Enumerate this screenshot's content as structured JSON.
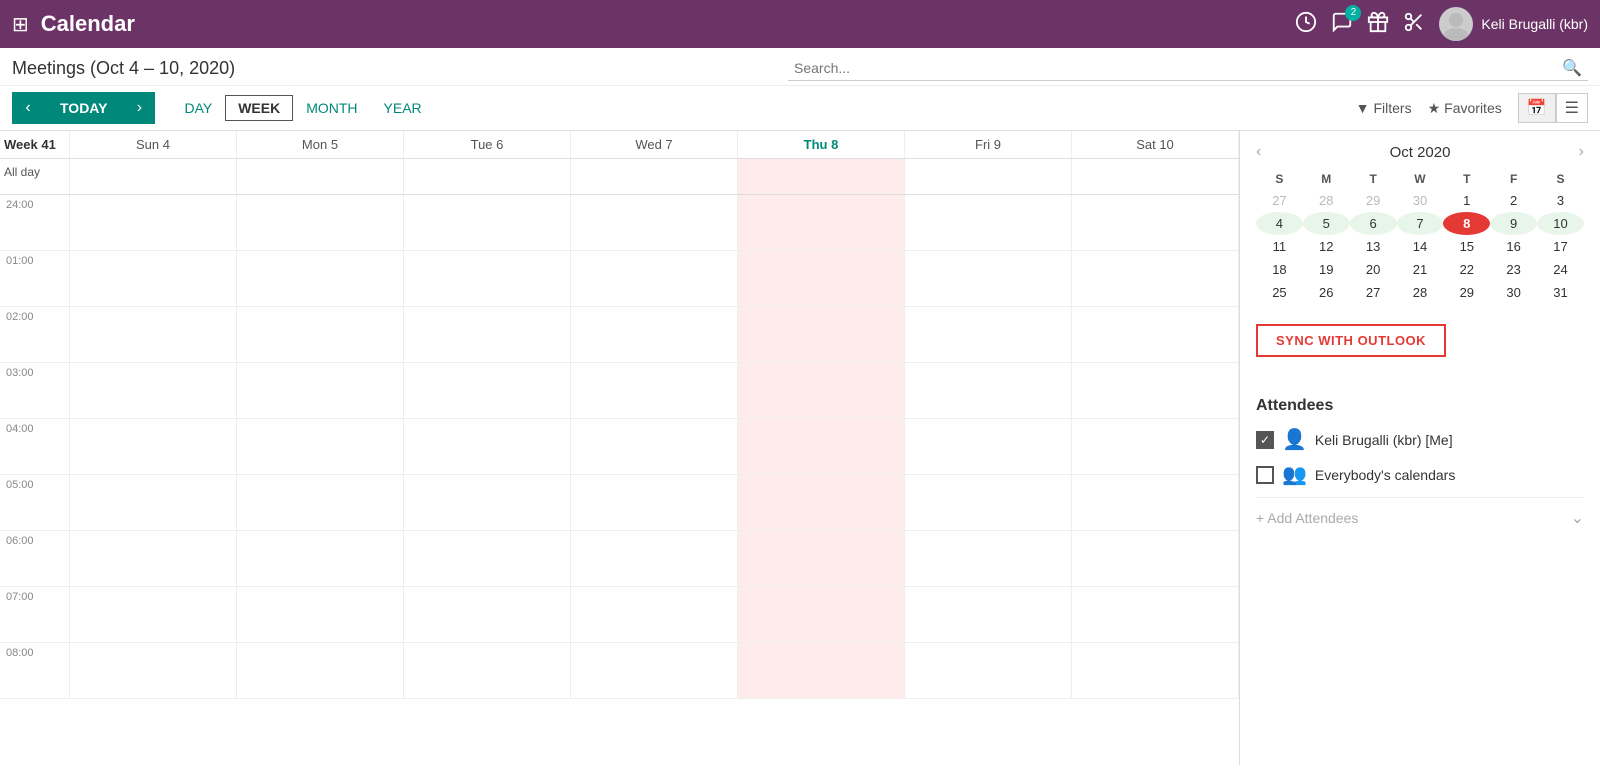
{
  "topnav": {
    "title": "Calendar",
    "chat_badge": "2",
    "user_name": "Keli Brugalli (kbr)"
  },
  "toolbar": {
    "title": "Meetings (Oct 4 – 10, 2020)",
    "search_placeholder": "Search..."
  },
  "nav": {
    "today_label": "TODAY",
    "prev_label": "‹",
    "next_label": "›",
    "views": [
      "DAY",
      "WEEK",
      "MONTH",
      "YEAR"
    ],
    "active_view": "WEEK",
    "filter_label": "Filters",
    "favorites_label": "Favorites"
  },
  "week_header": {
    "week_label": "Week 41",
    "days": [
      "Sun 4",
      "Mon 5",
      "Tue 6",
      "Wed 7",
      "Thu 8",
      "Fri 9",
      "Sat 10"
    ]
  },
  "time_labels": [
    "24:00",
    "01:00",
    "02:00",
    "03:00",
    "04:00",
    "05:00",
    "06:00",
    "07:00"
  ],
  "mini_cal": {
    "title": "Oct 2020",
    "day_headers": [
      "S",
      "M",
      "T",
      "W",
      "T",
      "F",
      "S"
    ],
    "weeks": [
      [
        {
          "n": "27",
          "other": true
        },
        {
          "n": "28",
          "other": true
        },
        {
          "n": "29",
          "other": true
        },
        {
          "n": "30",
          "other": true
        },
        {
          "n": "1"
        },
        {
          "n": "2"
        },
        {
          "n": "3"
        }
      ],
      [
        {
          "n": "4"
        },
        {
          "n": "5"
        },
        {
          "n": "6"
        },
        {
          "n": "7"
        },
        {
          "n": "8",
          "today": true
        },
        {
          "n": "9"
        },
        {
          "n": "10"
        }
      ],
      [
        {
          "n": "11"
        },
        {
          "n": "12"
        },
        {
          "n": "13"
        },
        {
          "n": "14"
        },
        {
          "n": "15"
        },
        {
          "n": "16"
        },
        {
          "n": "17"
        }
      ],
      [
        {
          "n": "18"
        },
        {
          "n": "19"
        },
        {
          "n": "20"
        },
        {
          "n": "21"
        },
        {
          "n": "22"
        },
        {
          "n": "23"
        },
        {
          "n": "24"
        }
      ],
      [
        {
          "n": "25"
        },
        {
          "n": "26"
        },
        {
          "n": "27"
        },
        {
          "n": "28"
        },
        {
          "n": "29"
        },
        {
          "n": "30"
        },
        {
          "n": "31"
        }
      ]
    ]
  },
  "sync_btn": {
    "label_black": "SYNC WITH ",
    "label_red": "OUTLOOK"
  },
  "attendees": {
    "title": "Attendees",
    "list": [
      {
        "name": "Keli Brugalli (kbr) [Me]",
        "checked": true,
        "icon": "person"
      },
      {
        "name": "Everybody's calendars",
        "checked": false,
        "icon": "group"
      }
    ],
    "add_label": "+ Add Attendees"
  }
}
